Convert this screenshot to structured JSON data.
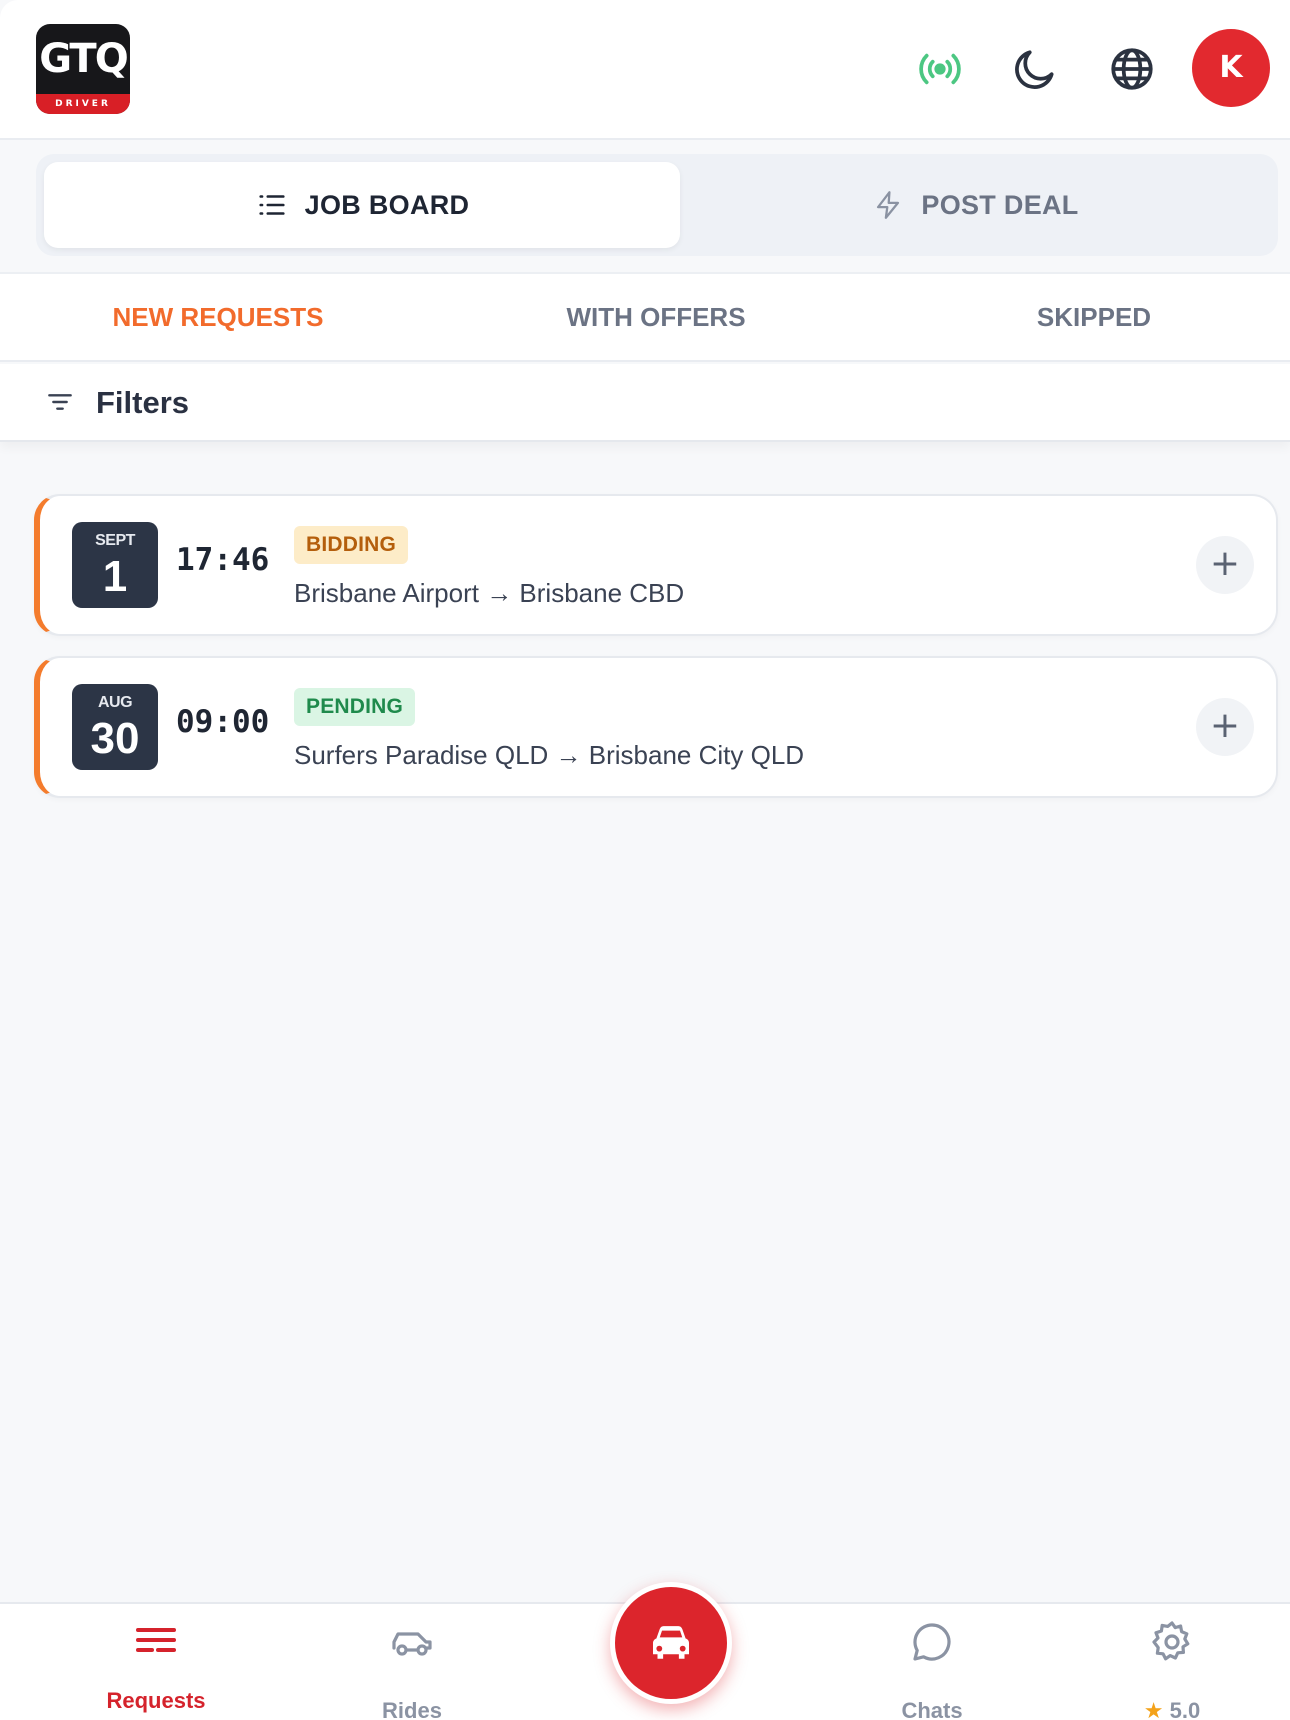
{
  "header": {
    "logo_text": "GTQ",
    "logo_sub": "DRIVER",
    "avatar_initial": "K"
  },
  "segmented": {
    "job_board": "JOB BOARD",
    "post_deal": "POST DEAL"
  },
  "subtabs": {
    "new_requests": "NEW REQUESTS",
    "with_offers": "WITH OFFERS",
    "skipped": "SKIPPED"
  },
  "filters": {
    "label": "Filters"
  },
  "requests": [
    {
      "month": "SEPT",
      "day": "1",
      "time": "17:46",
      "status": "BIDDING",
      "route": "Brisbane Airport → Brisbane CBD"
    },
    {
      "month": "AUG",
      "day": "30",
      "time": "09:00",
      "status": "PENDING",
      "route": "Surfers Paradise QLD → Brisbane City QLD"
    }
  ],
  "bottom_nav": {
    "requests": "Requests",
    "rides": "Rides",
    "chats": "Chats",
    "rating_star": "★",
    "rating": "5.0"
  },
  "colors": {
    "accent_red": "#dc252c",
    "accent_orange": "#f26b2c",
    "bidding_bg": "#fdecc8",
    "pending_bg": "#daf5e4"
  },
  "icons": [
    "broadcast-icon",
    "moon-icon",
    "globe-icon",
    "list-icon",
    "bolt-icon",
    "filter-icon",
    "plus-icon",
    "requests-icon",
    "car-outline-icon",
    "car-icon",
    "chat-icon",
    "gear-icon"
  ]
}
